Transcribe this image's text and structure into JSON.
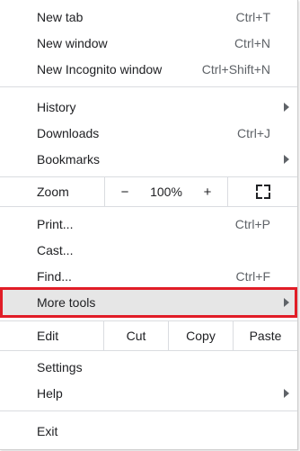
{
  "menu": {
    "new_tab": {
      "label": "New tab",
      "shortcut": "Ctrl+T"
    },
    "new_window": {
      "label": "New window",
      "shortcut": "Ctrl+N"
    },
    "new_incognito": {
      "label": "New Incognito window",
      "shortcut": "Ctrl+Shift+N"
    },
    "history": {
      "label": "History"
    },
    "downloads": {
      "label": "Downloads",
      "shortcut": "Ctrl+J"
    },
    "bookmarks": {
      "label": "Bookmarks"
    },
    "zoom": {
      "label": "Zoom",
      "minus": "−",
      "value": "100%",
      "plus": "+"
    },
    "print": {
      "label": "Print...",
      "shortcut": "Ctrl+P"
    },
    "cast": {
      "label": "Cast..."
    },
    "find": {
      "label": "Find...",
      "shortcut": "Ctrl+F"
    },
    "more_tools": {
      "label": "More tools"
    },
    "edit": {
      "label": "Edit",
      "cut": "Cut",
      "copy": "Copy",
      "paste": "Paste"
    },
    "settings": {
      "label": "Settings"
    },
    "help": {
      "label": "Help"
    },
    "exit": {
      "label": "Exit"
    }
  },
  "colors": {
    "highlight_border": "#e11d27",
    "highlight_background": "#e6e6e6",
    "separator": "#dadce0"
  },
  "icons": {
    "submenu": "chevron-right-icon",
    "fullscreen": "fullscreen-icon"
  }
}
